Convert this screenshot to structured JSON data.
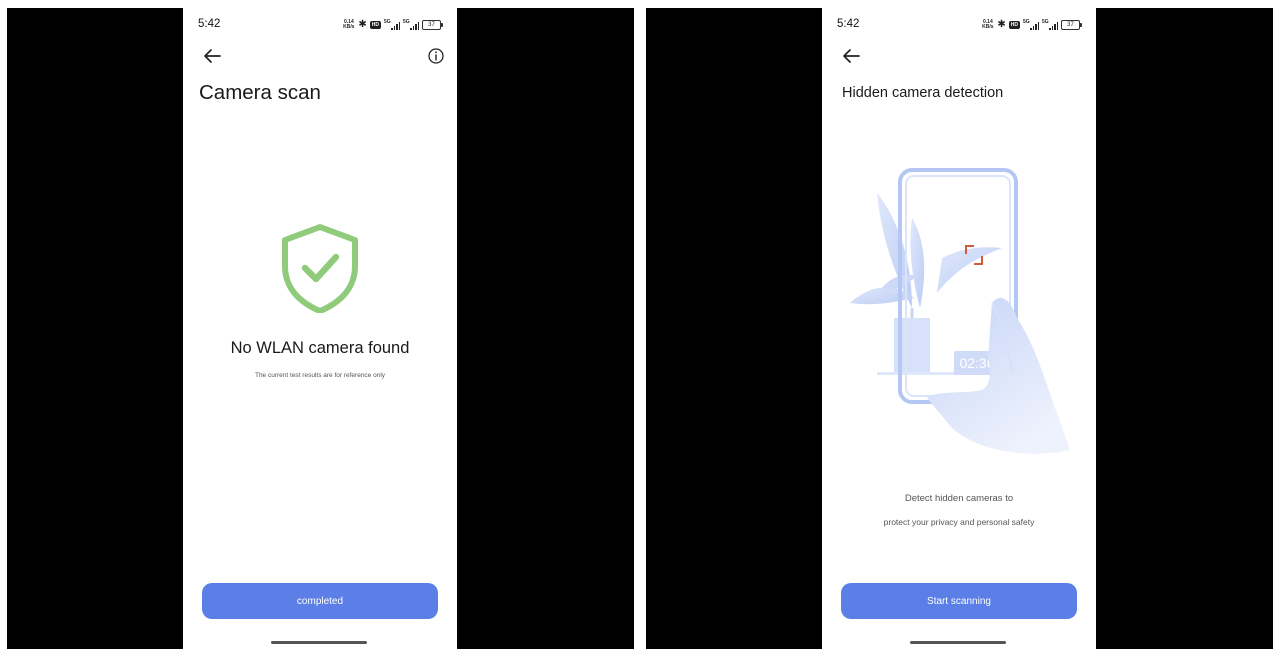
{
  "screens": [
    {
      "status": {
        "time": "5:42",
        "net_speed_top": "0.14",
        "net_speed_bottom": "KB/s",
        "network_1": "5G",
        "network_2": "5G",
        "battery": "37"
      },
      "title": "Camera scan",
      "result": "No WLAN camera found",
      "note": "The current test results are for reference only",
      "button_label": "completed",
      "icons": [
        "back-arrow-icon",
        "info-icon",
        "shield-check-icon"
      ],
      "colors": {
        "accent": "#5b7fe6",
        "shield": "#8fcb7b"
      }
    },
    {
      "status": {
        "time": "5:42",
        "net_speed_top": "0.14",
        "net_speed_bottom": "KB/s",
        "network_1": "5G",
        "network_2": "5G",
        "battery": "37"
      },
      "title": "Hidden camera detection",
      "illustration_time": "02:36",
      "description_line1": "Detect hidden cameras to",
      "description_line2": "protect your privacy and personal safety",
      "button_label": "Start scanning",
      "icons": [
        "back-arrow-icon",
        "hidden-camera-illustration"
      ],
      "colors": {
        "accent": "#5b7fe6",
        "focus_marker": "#d05a3c"
      }
    }
  ]
}
